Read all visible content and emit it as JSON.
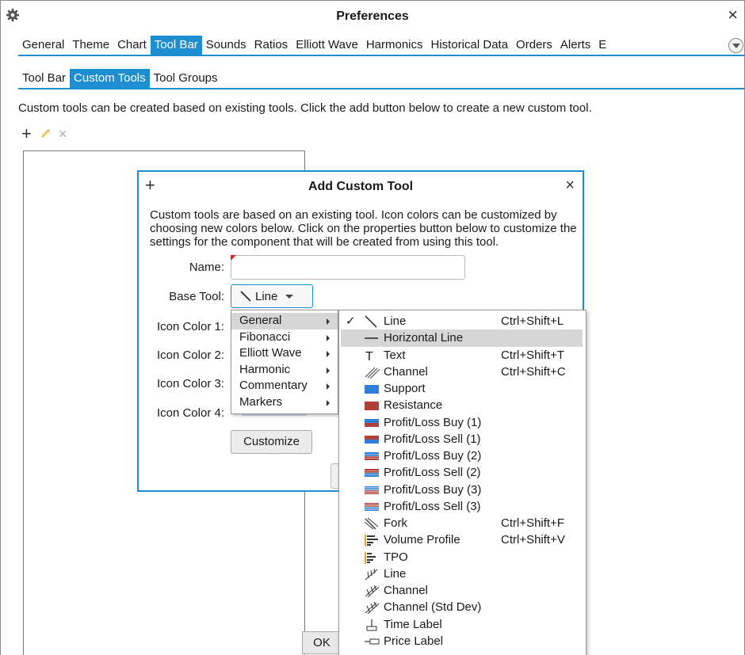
{
  "window": {
    "title": "Preferences",
    "close": "×"
  },
  "tabs": [
    "General",
    "Theme",
    "Chart",
    "Tool Bar",
    "Sounds",
    "Ratios",
    "Elliott Wave",
    "Harmonics",
    "Historical Data",
    "Orders",
    "Alerts",
    "E"
  ],
  "active_tab": "Tool Bar",
  "subtabs": [
    "Tool Bar",
    "Custom Tools",
    "Tool Groups"
  ],
  "active_subtab": "Custom Tools",
  "description": "Custom tools can be created based on existing tools.  Click the add button below to create a new custom tool.",
  "toolbar": {
    "add": "+",
    "delete": "×"
  },
  "ok_label": "OK",
  "dialog": {
    "plus": "+",
    "title": "Add Custom Tool",
    "close": "×",
    "description": "Custom tools are based on an existing tool.  Icon colors can be customized by choosing new colors below.  Click on the properties button below to customize the settings for the component that will be created from using this tool.",
    "name_label": "Name:",
    "name_value": "",
    "base_tool_label": "Base Tool:",
    "base_tool_value": "Line",
    "icon_color_labels": [
      "Icon Color 1:",
      "Icon Color 2:",
      "Icon Color 3:",
      "Icon Color 4:"
    ],
    "customize_label": "Customize"
  },
  "category_menu": [
    "General",
    "Fibonacci",
    "Elliott Wave",
    "Harmonic",
    "Commentary",
    "Markers"
  ],
  "selected_category": "General",
  "tool_menu": [
    {
      "label": "Line",
      "shortcut": "Ctrl+Shift+L",
      "checked": true,
      "icon": "line-icon"
    },
    {
      "label": "Horizontal Line",
      "shortcut": "",
      "icon": "horizontal-line-icon",
      "hover": true
    },
    {
      "label": "Text",
      "shortcut": "Ctrl+Shift+T",
      "icon": "text-icon"
    },
    {
      "label": "Channel",
      "shortcut": "Ctrl+Shift+C",
      "icon": "channel-icon"
    },
    {
      "label": "Support",
      "shortcut": "",
      "icon": "support-icon"
    },
    {
      "label": "Resistance",
      "shortcut": "",
      "icon": "resistance-icon"
    },
    {
      "label": "Profit/Loss Buy (1)",
      "shortcut": "",
      "icon": "profit-loss-buy-1-icon"
    },
    {
      "label": "Profit/Loss Sell (1)",
      "shortcut": "",
      "icon": "profit-loss-sell-1-icon"
    },
    {
      "label": "Profit/Loss Buy (2)",
      "shortcut": "",
      "icon": "profit-loss-buy-2-icon"
    },
    {
      "label": "Profit/Loss Sell (2)",
      "shortcut": "",
      "icon": "profit-loss-sell-2-icon"
    },
    {
      "label": "Profit/Loss Buy (3)",
      "shortcut": "",
      "icon": "profit-loss-buy-3-icon"
    },
    {
      "label": "Profit/Loss Sell (3)",
      "shortcut": "",
      "icon": "profit-loss-sell-3-icon"
    },
    {
      "label": "Fork",
      "shortcut": "Ctrl+Shift+F",
      "icon": "fork-icon"
    },
    {
      "label": "Volume Profile",
      "shortcut": "Ctrl+Shift+V",
      "icon": "volume-profile-icon"
    },
    {
      "label": "TPO",
      "shortcut": "",
      "icon": "tpo-icon"
    },
    {
      "label": "Line",
      "shortcut": "",
      "icon": "gann-line-icon"
    },
    {
      "label": "Channel",
      "shortcut": "",
      "icon": "gann-channel-icon"
    },
    {
      "label": "Channel (Std Dev)",
      "shortcut": "",
      "icon": "std-dev-channel-icon"
    },
    {
      "label": "Time Label",
      "shortcut": "",
      "icon": "time-label-icon"
    },
    {
      "label": "Price Label",
      "shortcut": "",
      "icon": "price-label-icon"
    }
  ],
  "colors": {
    "accent": "#1d8fd0",
    "support": "#2f7fd6",
    "resistance": "#b0413a",
    "highlight": "#d6d6d6"
  }
}
